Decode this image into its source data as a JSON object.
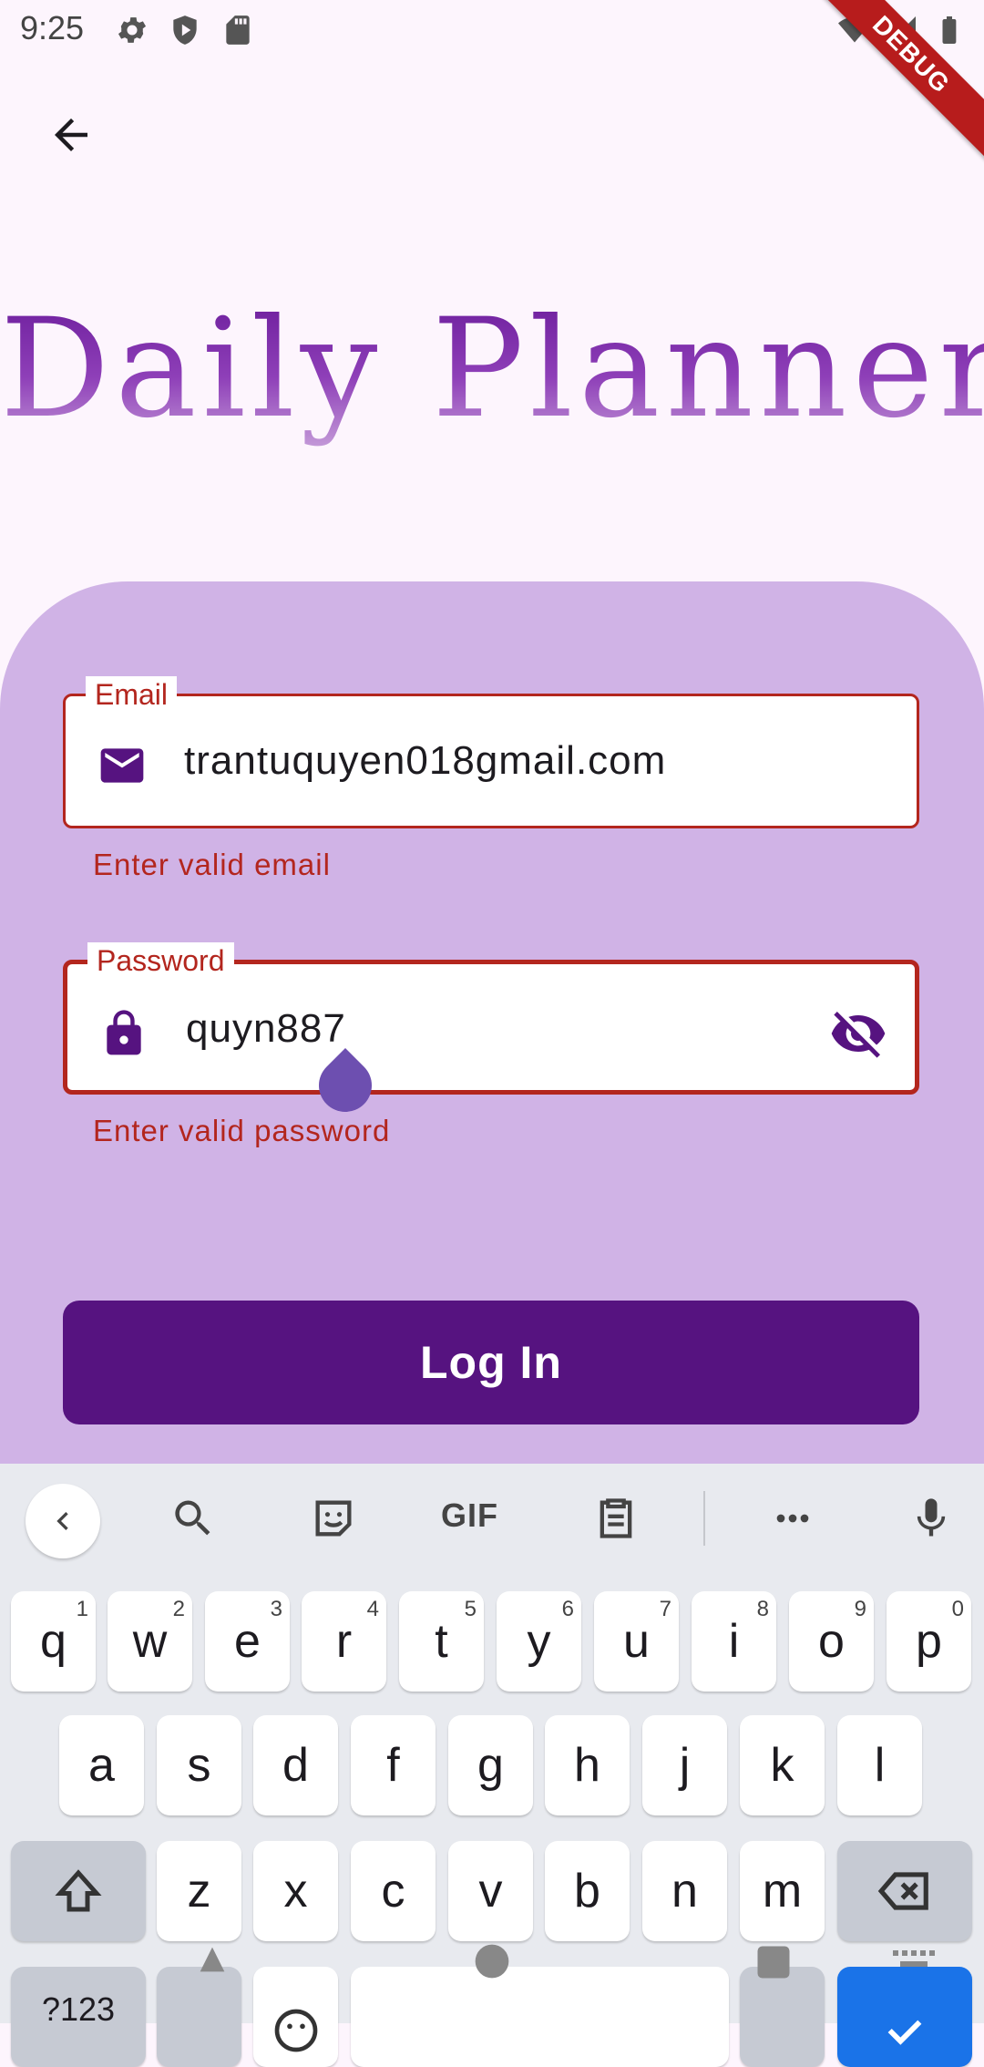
{
  "status_bar": {
    "time": "9:25",
    "debug_label": "DEBUG"
  },
  "app": {
    "title": "Daily Planner"
  },
  "form": {
    "email": {
      "label": "Email",
      "value": "trantuquyen018gmail.com",
      "error": "Enter valid email"
    },
    "password": {
      "label": "Password",
      "value": "quyn887",
      "error": "Enter valid password"
    },
    "login_label": "Log In"
  },
  "keyboard": {
    "toolbar": {
      "gif_label": "GIF"
    },
    "row1": [
      {
        "key": "q",
        "hint": "1"
      },
      {
        "key": "w",
        "hint": "2"
      },
      {
        "key": "e",
        "hint": "3"
      },
      {
        "key": "r",
        "hint": "4"
      },
      {
        "key": "t",
        "hint": "5"
      },
      {
        "key": "y",
        "hint": "6"
      },
      {
        "key": "u",
        "hint": "7"
      },
      {
        "key": "i",
        "hint": "8"
      },
      {
        "key": "o",
        "hint": "9"
      },
      {
        "key": "p",
        "hint": "0"
      }
    ],
    "row2": [
      "a",
      "s",
      "d",
      "f",
      "g",
      "h",
      "j",
      "k",
      "l"
    ],
    "row3": [
      "z",
      "x",
      "c",
      "v",
      "b",
      "n",
      "m"
    ],
    "symbols_label": "?123"
  },
  "colors": {
    "accent": "#561380",
    "error": "#b3261e",
    "card": "#d0b3e6",
    "background": "#fdf5fd"
  }
}
